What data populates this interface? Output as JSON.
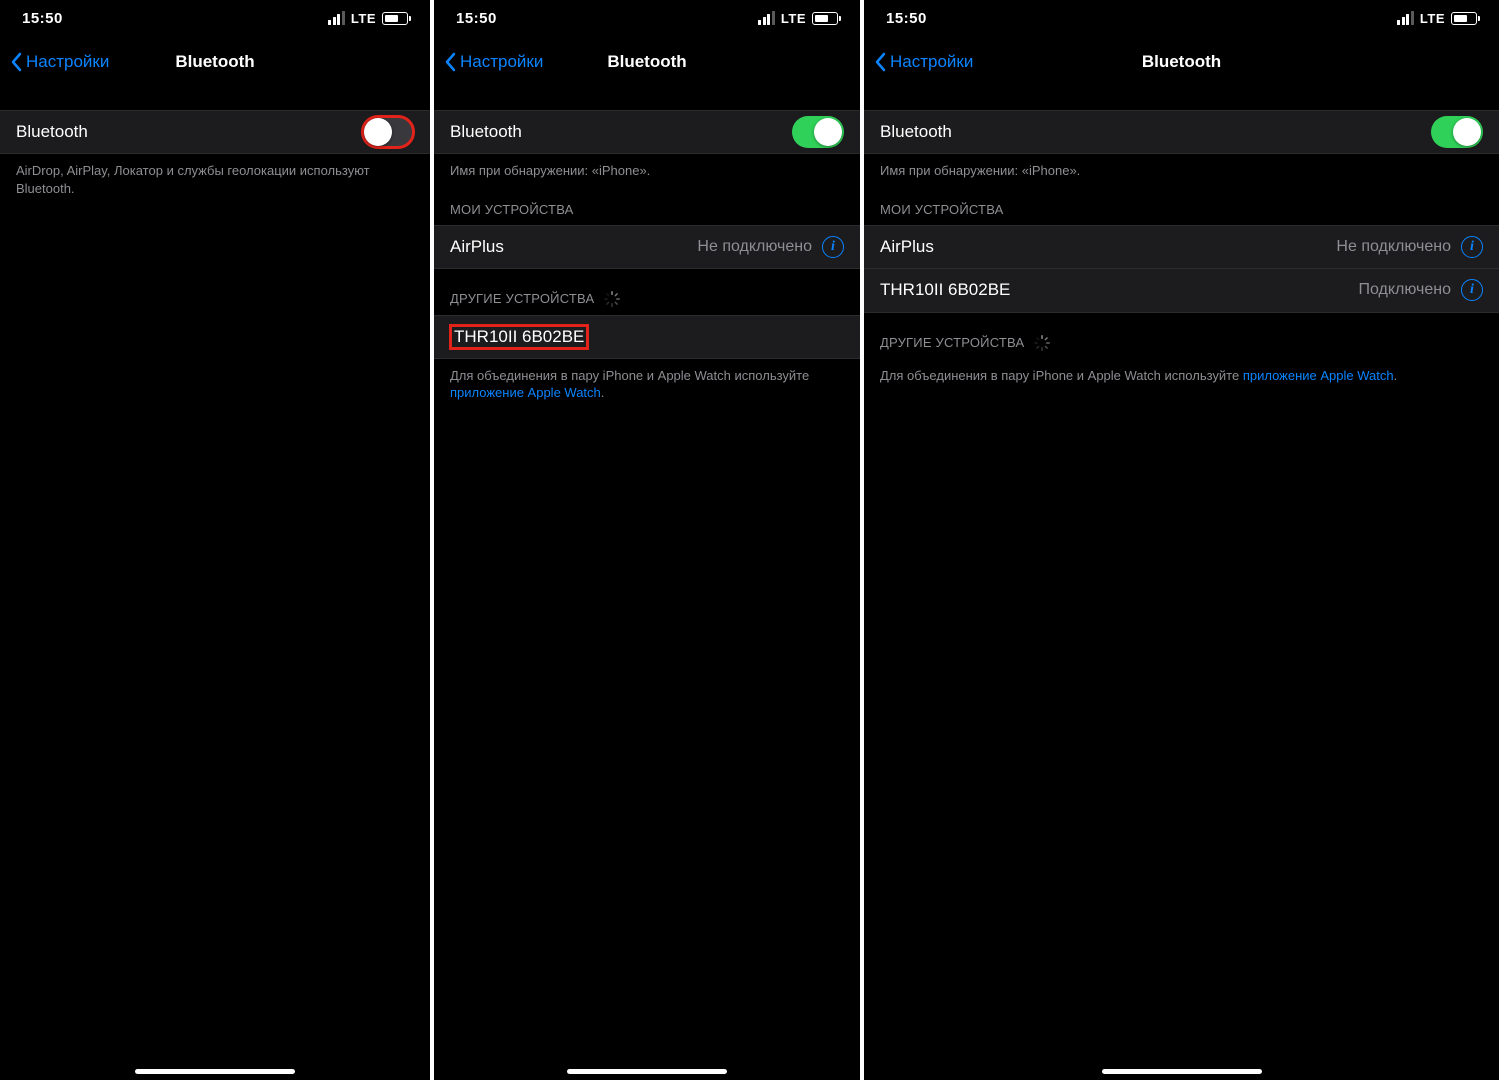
{
  "status": {
    "time": "15:50",
    "carrier": "LTE"
  },
  "nav": {
    "back": "Настройки",
    "title": "Bluetooth"
  },
  "toggle": {
    "label": "Bluetooth"
  },
  "screen1": {
    "note": "AirDrop, AirPlay, Локатор и службы геолокации используют Bluetooth."
  },
  "screen2": {
    "discovery_note": "Имя при обнаружении: «iPhone».",
    "my_devices_header": "МОИ УСТРОЙСТВА",
    "other_devices_header": "ДРУГИЕ УСТРОЙСТВА",
    "devices": {
      "airplus": {
        "name": "AirPlus",
        "status": "Не подключено"
      },
      "thr": {
        "name": "THR10II 6B02BE"
      }
    },
    "pairing_note_a": "Для объединения в пару iPhone и Apple Watch используйте ",
    "pairing_note_link": "приложение Apple Watch",
    "pairing_note_b": "."
  },
  "screen3": {
    "discovery_note": "Имя при обнаружении: «iPhone».",
    "my_devices_header": "МОИ УСТРОЙСТВА",
    "other_devices_header": "ДРУГИЕ УСТРОЙСТВА",
    "devices": {
      "airplus": {
        "name": "AirPlus",
        "status": "Не подключено"
      },
      "thr": {
        "name": "THR10II 6B02BE",
        "status": "Подключено"
      }
    },
    "pairing_note_a": "Для объединения в пару iPhone и Apple Watch используйте ",
    "pairing_note_link": "приложение Apple Watch",
    "pairing_note_b": "."
  }
}
